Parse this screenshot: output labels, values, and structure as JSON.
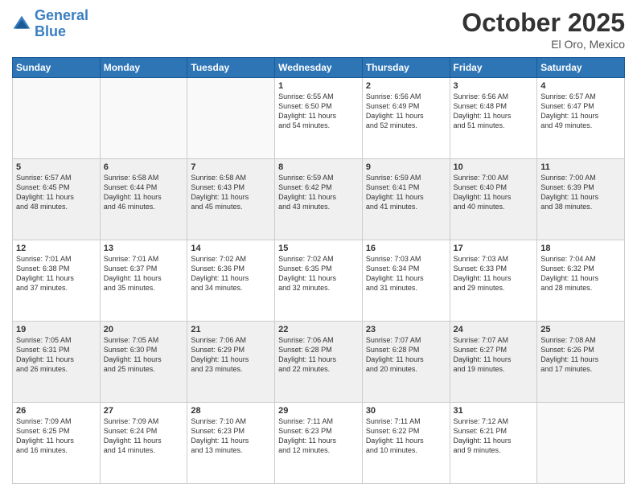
{
  "header": {
    "logo_line1": "General",
    "logo_line2": "Blue",
    "month": "October 2025",
    "location": "El Oro, Mexico"
  },
  "days_of_week": [
    "Sunday",
    "Monday",
    "Tuesday",
    "Wednesday",
    "Thursday",
    "Friday",
    "Saturday"
  ],
  "weeks": [
    [
      {
        "day": "",
        "info": ""
      },
      {
        "day": "",
        "info": ""
      },
      {
        "day": "",
        "info": ""
      },
      {
        "day": "1",
        "info": "Sunrise: 6:55 AM\nSunset: 6:50 PM\nDaylight: 11 hours\nand 54 minutes."
      },
      {
        "day": "2",
        "info": "Sunrise: 6:56 AM\nSunset: 6:49 PM\nDaylight: 11 hours\nand 52 minutes."
      },
      {
        "day": "3",
        "info": "Sunrise: 6:56 AM\nSunset: 6:48 PM\nDaylight: 11 hours\nand 51 minutes."
      },
      {
        "day": "4",
        "info": "Sunrise: 6:57 AM\nSunset: 6:47 PM\nDaylight: 11 hours\nand 49 minutes."
      }
    ],
    [
      {
        "day": "5",
        "info": "Sunrise: 6:57 AM\nSunset: 6:45 PM\nDaylight: 11 hours\nand 48 minutes."
      },
      {
        "day": "6",
        "info": "Sunrise: 6:58 AM\nSunset: 6:44 PM\nDaylight: 11 hours\nand 46 minutes."
      },
      {
        "day": "7",
        "info": "Sunrise: 6:58 AM\nSunset: 6:43 PM\nDaylight: 11 hours\nand 45 minutes."
      },
      {
        "day": "8",
        "info": "Sunrise: 6:59 AM\nSunset: 6:42 PM\nDaylight: 11 hours\nand 43 minutes."
      },
      {
        "day": "9",
        "info": "Sunrise: 6:59 AM\nSunset: 6:41 PM\nDaylight: 11 hours\nand 41 minutes."
      },
      {
        "day": "10",
        "info": "Sunrise: 7:00 AM\nSunset: 6:40 PM\nDaylight: 11 hours\nand 40 minutes."
      },
      {
        "day": "11",
        "info": "Sunrise: 7:00 AM\nSunset: 6:39 PM\nDaylight: 11 hours\nand 38 minutes."
      }
    ],
    [
      {
        "day": "12",
        "info": "Sunrise: 7:01 AM\nSunset: 6:38 PM\nDaylight: 11 hours\nand 37 minutes."
      },
      {
        "day": "13",
        "info": "Sunrise: 7:01 AM\nSunset: 6:37 PM\nDaylight: 11 hours\nand 35 minutes."
      },
      {
        "day": "14",
        "info": "Sunrise: 7:02 AM\nSunset: 6:36 PM\nDaylight: 11 hours\nand 34 minutes."
      },
      {
        "day": "15",
        "info": "Sunrise: 7:02 AM\nSunset: 6:35 PM\nDaylight: 11 hours\nand 32 minutes."
      },
      {
        "day": "16",
        "info": "Sunrise: 7:03 AM\nSunset: 6:34 PM\nDaylight: 11 hours\nand 31 minutes."
      },
      {
        "day": "17",
        "info": "Sunrise: 7:03 AM\nSunset: 6:33 PM\nDaylight: 11 hours\nand 29 minutes."
      },
      {
        "day": "18",
        "info": "Sunrise: 7:04 AM\nSunset: 6:32 PM\nDaylight: 11 hours\nand 28 minutes."
      }
    ],
    [
      {
        "day": "19",
        "info": "Sunrise: 7:05 AM\nSunset: 6:31 PM\nDaylight: 11 hours\nand 26 minutes."
      },
      {
        "day": "20",
        "info": "Sunrise: 7:05 AM\nSunset: 6:30 PM\nDaylight: 11 hours\nand 25 minutes."
      },
      {
        "day": "21",
        "info": "Sunrise: 7:06 AM\nSunset: 6:29 PM\nDaylight: 11 hours\nand 23 minutes."
      },
      {
        "day": "22",
        "info": "Sunrise: 7:06 AM\nSunset: 6:28 PM\nDaylight: 11 hours\nand 22 minutes."
      },
      {
        "day": "23",
        "info": "Sunrise: 7:07 AM\nSunset: 6:28 PM\nDaylight: 11 hours\nand 20 minutes."
      },
      {
        "day": "24",
        "info": "Sunrise: 7:07 AM\nSunset: 6:27 PM\nDaylight: 11 hours\nand 19 minutes."
      },
      {
        "day": "25",
        "info": "Sunrise: 7:08 AM\nSunset: 6:26 PM\nDaylight: 11 hours\nand 17 minutes."
      }
    ],
    [
      {
        "day": "26",
        "info": "Sunrise: 7:09 AM\nSunset: 6:25 PM\nDaylight: 11 hours\nand 16 minutes."
      },
      {
        "day": "27",
        "info": "Sunrise: 7:09 AM\nSunset: 6:24 PM\nDaylight: 11 hours\nand 14 minutes."
      },
      {
        "day": "28",
        "info": "Sunrise: 7:10 AM\nSunset: 6:23 PM\nDaylight: 11 hours\nand 13 minutes."
      },
      {
        "day": "29",
        "info": "Sunrise: 7:11 AM\nSunset: 6:23 PM\nDaylight: 11 hours\nand 12 minutes."
      },
      {
        "day": "30",
        "info": "Sunrise: 7:11 AM\nSunset: 6:22 PM\nDaylight: 11 hours\nand 10 minutes."
      },
      {
        "day": "31",
        "info": "Sunrise: 7:12 AM\nSunset: 6:21 PM\nDaylight: 11 hours\nand 9 minutes."
      },
      {
        "day": "",
        "info": ""
      }
    ]
  ]
}
